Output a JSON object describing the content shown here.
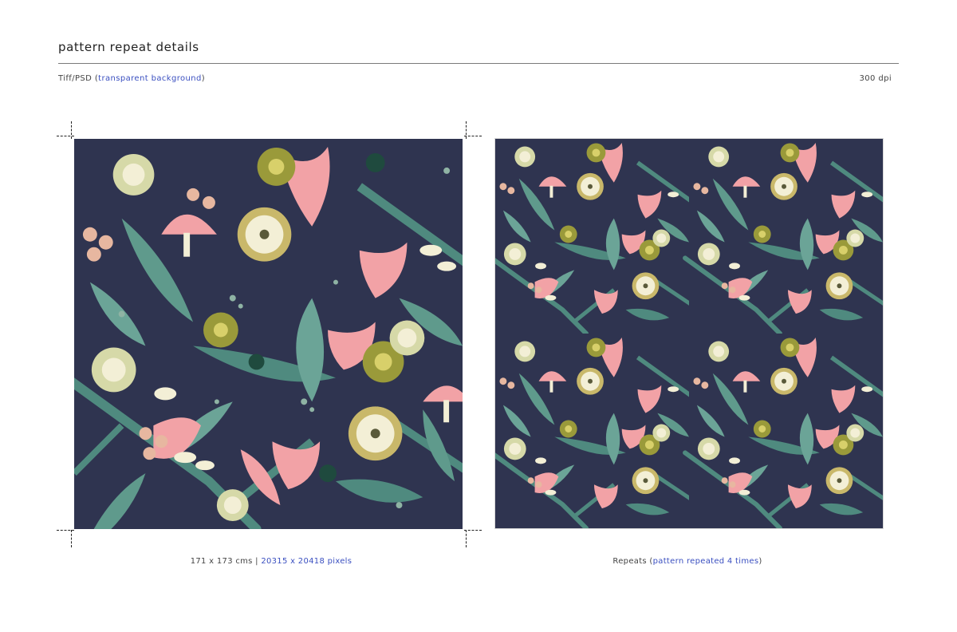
{
  "header": {
    "title": "pattern repeat details",
    "format_label": "Tiff/PSD (",
    "format_highlight": "transparent background",
    "format_close": ")",
    "resolution": "300 dpi"
  },
  "single_panel": {
    "caption_size": "171 x 173 cms |",
    "caption_pixels": "20315 x 20418 pixels"
  },
  "repeat_panel": {
    "caption_label": "Repeats (",
    "caption_highlight": "pattern repeated 4 times",
    "caption_close": ")"
  },
  "colors": {
    "background_navy": "#2f3450",
    "teal": "#4f8a7f",
    "sage": "#8fb3a4",
    "olive": "#9a9a3a",
    "pink": "#f2a2a6",
    "cream": "#f3efd6",
    "dark_green": "#1f4a3e",
    "accent_blue": "#3a4fc0"
  },
  "icons": [
    "floral-motif"
  ]
}
